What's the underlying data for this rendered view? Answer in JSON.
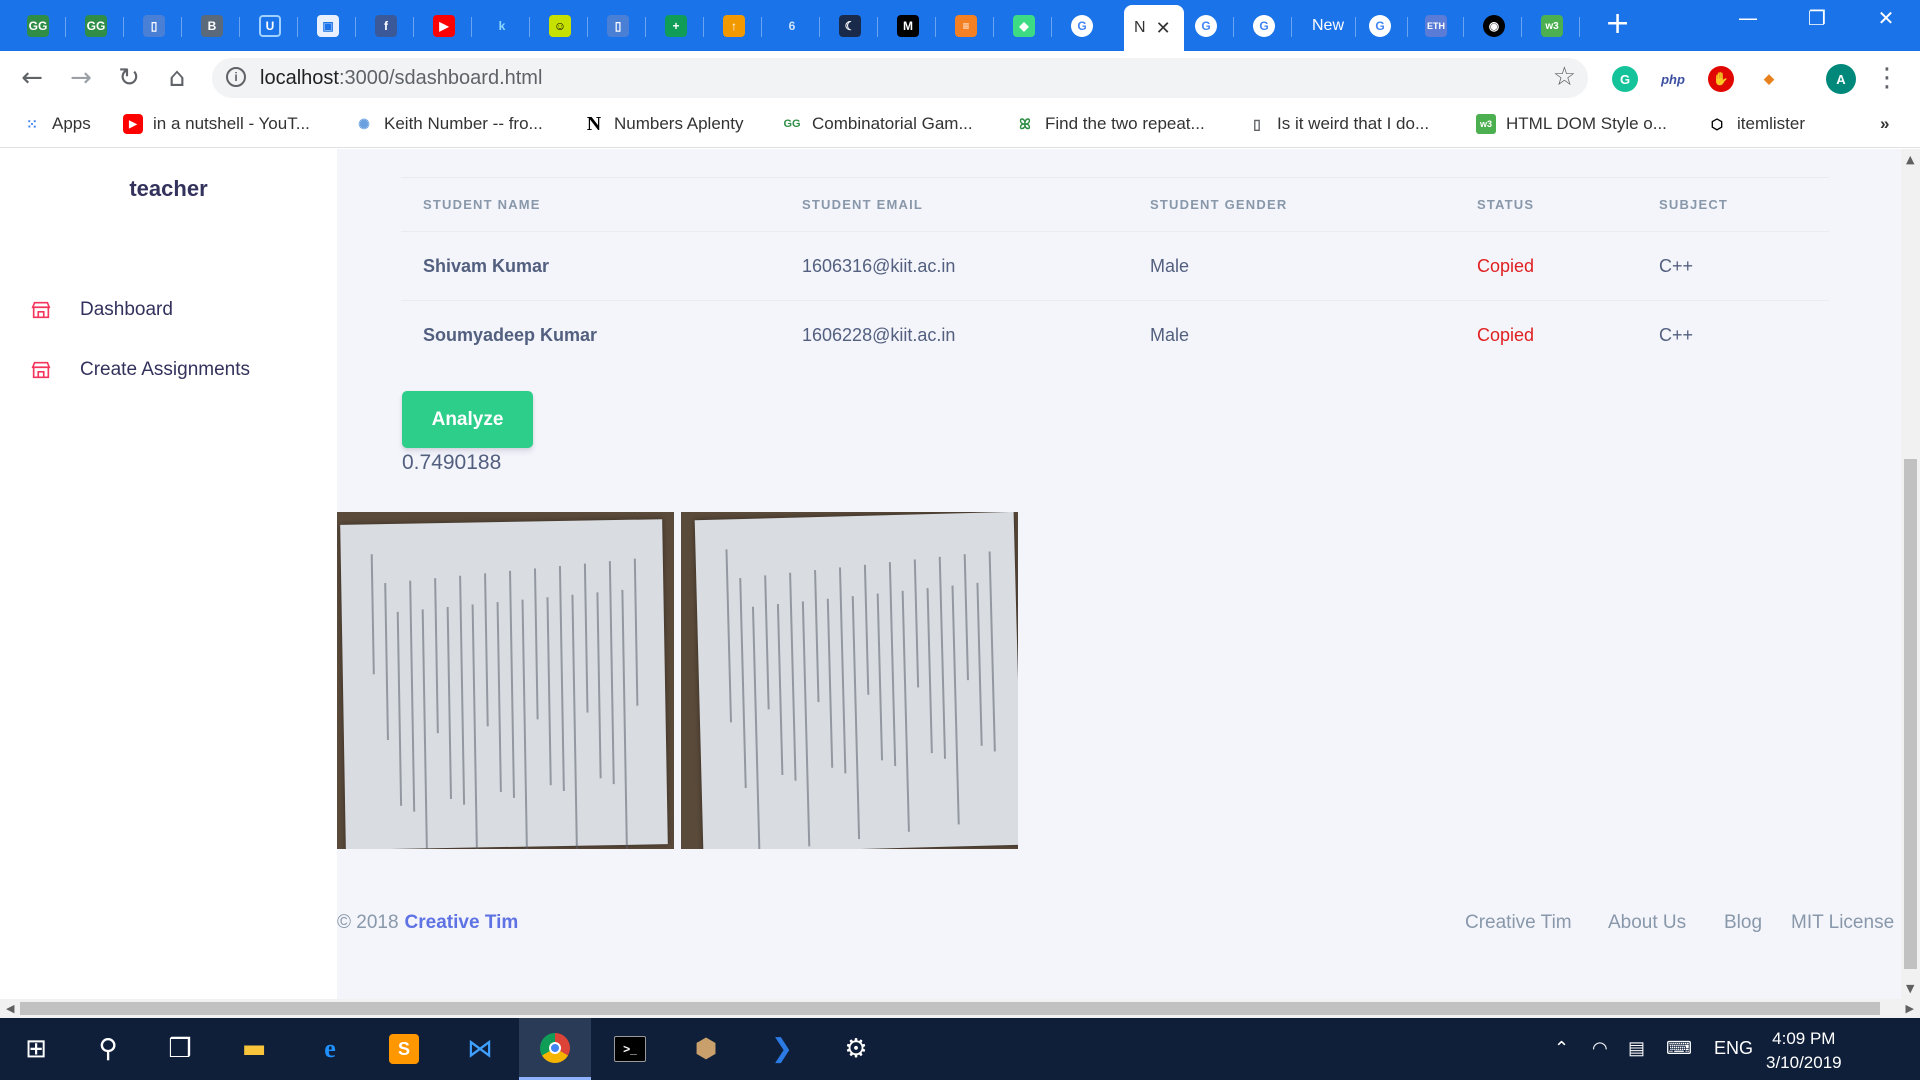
{
  "browser": {
    "active_tab_label": "N",
    "partial_tab_label": "New",
    "url_host": "localhost",
    "url_path": ":3000/sdashboard.html",
    "info_icon": "info-icon",
    "bookmarks": [
      {
        "label": "Apps",
        "icon": "apps-grid-icon"
      },
      {
        "label": "in a nutshell - YouT...",
        "icon": "youtube-icon"
      },
      {
        "label": "Keith Number -- fro...",
        "icon": "wolfram-icon"
      },
      {
        "label": "Numbers Aplenty",
        "icon": "numbers-aplenty-icon"
      },
      {
        "label": "Combinatorial Gam...",
        "icon": "geeksforgeeks-icon"
      },
      {
        "label": "Find the two repeat...",
        "icon": "geeksforgeeks-icon"
      },
      {
        "label": "Is it weird that I do...",
        "icon": "document-icon"
      },
      {
        "label": "HTML DOM Style o...",
        "icon": "w3schools-icon"
      },
      {
        "label": "itemlister",
        "icon": "codepen-icon"
      }
    ],
    "more_bookmarks": "»",
    "extensions": {
      "php": "php",
      "profile": "A"
    }
  },
  "sidebar": {
    "brand": "teacher",
    "items": [
      {
        "label": "Dashboard",
        "icon": "shop-icon"
      },
      {
        "label": "Create Assignments",
        "icon": "shop-icon"
      }
    ]
  },
  "table": {
    "headers": [
      "STUDENT NAME",
      "STUDENT EMAIL",
      "STUDENT GENDER",
      "STATUS",
      "SUBJECT"
    ],
    "rows": [
      {
        "name": "Shivam Kumar",
        "email": "1606316@kiit.ac.in",
        "gender": "Male",
        "status": "Copied",
        "subject": "C++"
      },
      {
        "name": "Soumyadeep Kumar",
        "email": "1606228@kiit.ac.in",
        "gender": "Male",
        "status": "Copied",
        "subject": "C++"
      }
    ]
  },
  "analyze": {
    "button_label": "Analyze",
    "score": "0.7490188"
  },
  "images": [
    {
      "name": "handwritten-page-1"
    },
    {
      "name": "handwritten-page-2"
    }
  ],
  "footer": {
    "copyright": "© 2018",
    "brand": "Creative Tim",
    "links": [
      "Creative Tim",
      "About Us",
      "Blog",
      "MIT License"
    ]
  },
  "taskbar": {
    "language": "ENG",
    "time": "4:09 PM",
    "date": "3/10/2019"
  },
  "colors": {
    "tabstrip": "#1a73e8",
    "accent_green": "#2dce89",
    "status_copied": "#e02020",
    "nav_icon": "#f5365c",
    "link": "#5e72e4"
  }
}
